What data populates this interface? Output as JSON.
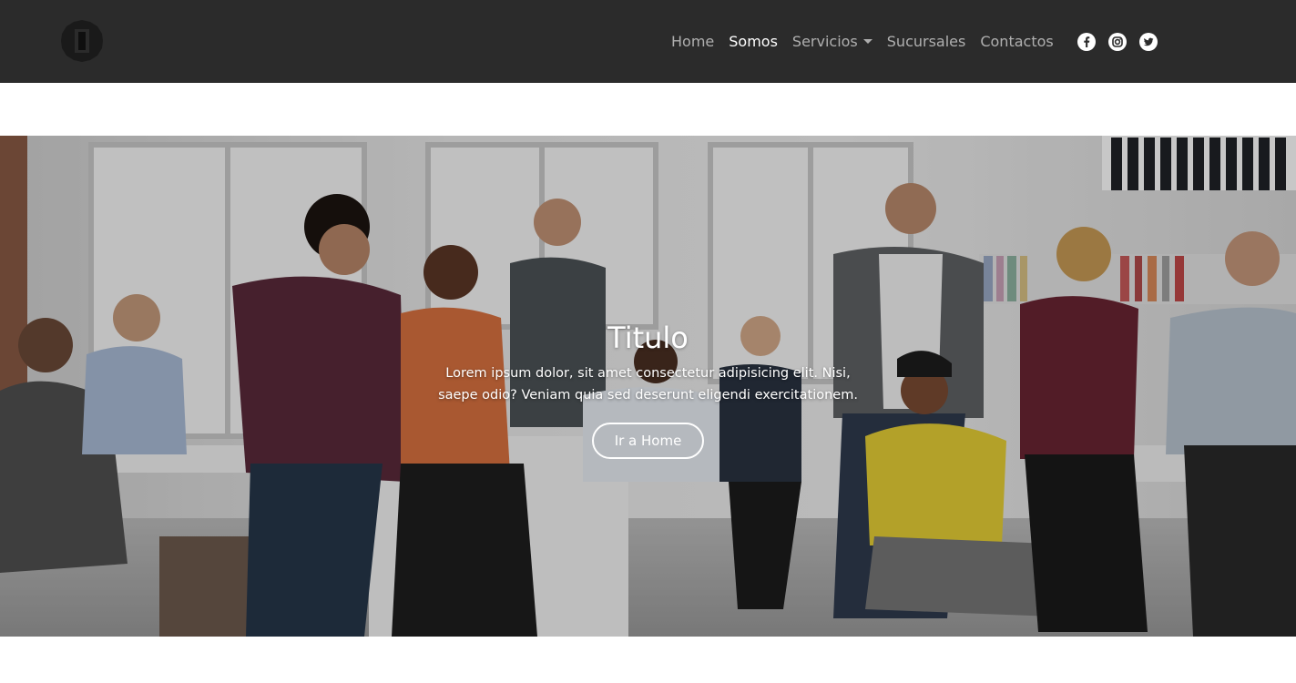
{
  "navbar": {
    "brand_icon": "octagon-logo-icon",
    "links": [
      {
        "label": "Home",
        "active": false
      },
      {
        "label": "Somos",
        "active": true
      },
      {
        "label": "Servicios",
        "active": false,
        "dropdown": true
      },
      {
        "label": "Sucursales",
        "active": false
      },
      {
        "label": "Contactos",
        "active": false
      }
    ],
    "social": [
      "facebook-icon",
      "instagram-icon",
      "twitter-icon"
    ]
  },
  "hero": {
    "image": "office-team-photo",
    "title": "Titulo",
    "text": "Lorem ipsum dolor, sit amet consectetur adipisicing elit. Nisi, saepe odio? Veniam quia sed deserunt eligendi exercitationem.",
    "button_label": "Ir a Home"
  },
  "colors": {
    "navbar_bg": "#2b2b2b",
    "nav_text": "#9d9d9d",
    "nav_active": "#ffffff"
  }
}
